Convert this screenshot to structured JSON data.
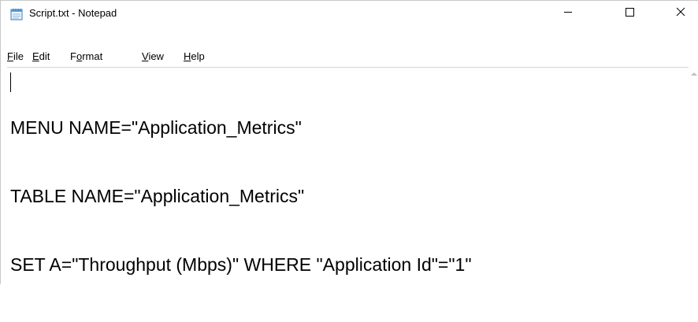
{
  "window": {
    "title": "Script.txt - Notepad",
    "icon": "notepad-icon"
  },
  "controls": {
    "minimize_icon": "minimize-icon",
    "maximize_icon": "maximize-icon",
    "close_icon": "close-icon"
  },
  "menu": {
    "file_mnemonic": "F",
    "file_rest": "ile",
    "edit_mnemonic": "E",
    "edit_rest": "dit",
    "format_pre": "F",
    "format_mnemonic": "o",
    "format_rest": "rmat",
    "view_mnemonic": "V",
    "view_rest": "iew",
    "help_mnemonic": "H",
    "help_rest": "elp"
  },
  "editor": {
    "lines": [
      "MENU NAME=\"Application_Metrics\"",
      "TABLE NAME=\"Application_Metrics\"",
      "SET A=\"Throughput (Mbps)\" WHERE \"Application Id\"=\"1\""
    ]
  }
}
